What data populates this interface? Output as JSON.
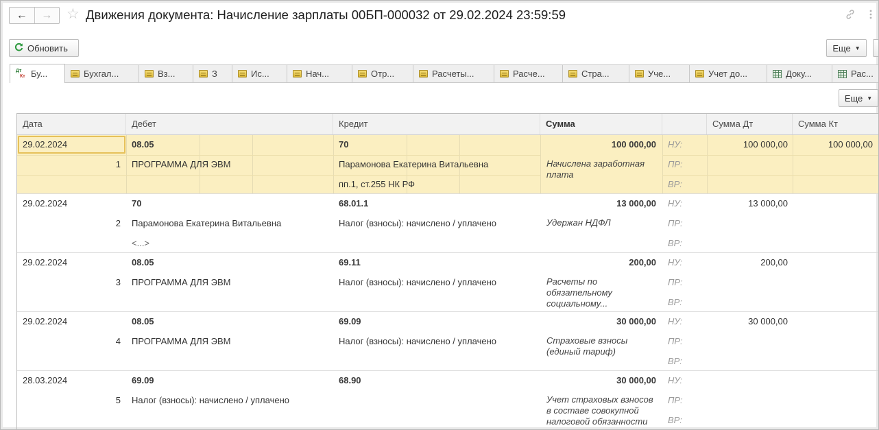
{
  "header": {
    "title": "Движения документа: Начисление зарплаты 00БП-000032 от 29.02.2024 23:59:59",
    "back_icon": "←",
    "forward_icon": "→",
    "star_icon": "☆"
  },
  "toolbar": {
    "refresh_label": "Обновить",
    "more_label": "Еще",
    "table_more_label": "Еще"
  },
  "tabs": [
    {
      "label": "Бу...",
      "icon": "dt-kt-icon",
      "active": true
    },
    {
      "label": "Бухгал...",
      "icon": "register-icon"
    },
    {
      "label": "Вз...",
      "icon": "register-icon"
    },
    {
      "label": "З",
      "icon": "register-icon"
    },
    {
      "label": "Ис...",
      "icon": "register-icon"
    },
    {
      "label": "Нач...",
      "icon": "register-icon"
    },
    {
      "label": "Отр...",
      "icon": "register-icon"
    },
    {
      "label": "Расчеты...",
      "icon": "register-icon"
    },
    {
      "label": "Расче...",
      "icon": "register-icon"
    },
    {
      "label": "Стра...",
      "icon": "register-icon"
    },
    {
      "label": "Уче...",
      "icon": "register-icon"
    },
    {
      "label": "Учет до...",
      "icon": "register-icon"
    },
    {
      "label": "Доку...",
      "icon": "grid-icon"
    },
    {
      "label": "Рас...",
      "icon": "grid-icon"
    }
  ],
  "table": {
    "columns": [
      "Дата",
      "Дебет",
      "Кредит",
      "Сумма",
      "",
      "Сумма Дт",
      "Сумма Кт"
    ],
    "labels": {
      "nu": "НУ:",
      "pr": "ПР:",
      "vr": "ВР:"
    },
    "rows": [
      {
        "date": "29.02.2024",
        "num": "1",
        "debit": "08.05",
        "debit_sub1": "ПРОГРАММА ДЛЯ ЭВМ",
        "debit_sub2": "",
        "credit": "70",
        "credit_sub1": "Парамонова Екатерина Витальевна",
        "credit_sub2": "пп.1, ст.255 НК РФ",
        "amount": "100 000,00",
        "content": "Начислена заработная плата",
        "amount_dt": "100 000,00",
        "amount_kt": "100 000,00"
      },
      {
        "date": "29.02.2024",
        "num": "2",
        "debit": "70",
        "debit_sub1": "Парамонова Екатерина Витальевна",
        "debit_sub2": "<...>",
        "credit": "68.01.1",
        "credit_sub1": "Налог (взносы): начислено / уплачено",
        "credit_sub2": "",
        "amount": "13 000,00",
        "content": "Удержан НДФЛ",
        "amount_dt": "13 000,00",
        "amount_kt": ""
      },
      {
        "date": "29.02.2024",
        "num": "3",
        "debit": "08.05",
        "debit_sub1": "ПРОГРАММА ДЛЯ ЭВМ",
        "debit_sub2": "",
        "credit": "69.11",
        "credit_sub1": "Налог (взносы): начислено / уплачено",
        "credit_sub2": "",
        "amount": "200,00",
        "content": "Расчеты по обязательному социальному...",
        "amount_dt": "200,00",
        "amount_kt": ""
      },
      {
        "date": "29.02.2024",
        "num": "4",
        "debit": "08.05",
        "debit_sub1": "ПРОГРАММА ДЛЯ ЭВМ",
        "debit_sub2": "",
        "credit": "69.09",
        "credit_sub1": "Налог (взносы): начислено / уплачено",
        "credit_sub2": "",
        "amount": "30 000,00",
        "content": "Страховые взносы (единый тариф)",
        "amount_dt": "30 000,00",
        "amount_kt": ""
      },
      {
        "date": "28.03.2024",
        "num": "5",
        "debit": "69.09",
        "debit_sub1": "Налог (взносы): начислено / уплачено",
        "debit_sub2": "",
        "credit": "68.90",
        "credit_sub1": "",
        "credit_sub2": "",
        "amount": "30 000,00",
        "content": "Учет страховых взносов в составе совокупной налоговой обязанности",
        "amount_dt": "",
        "amount_kt": ""
      }
    ]
  },
  "colors": {
    "selected_row": "#fbefc1",
    "accent_green": "#2e9a3f"
  }
}
